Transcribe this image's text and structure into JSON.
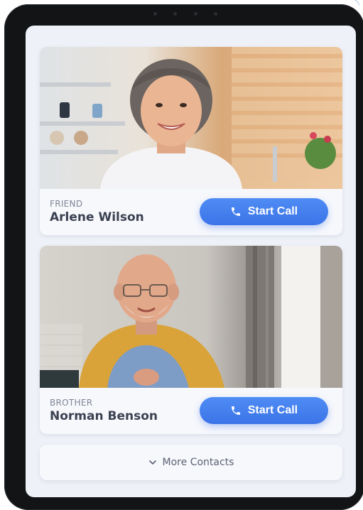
{
  "contacts": [
    {
      "relation": "FRIEND",
      "name": "Arlene Wilson",
      "call_label": "Start Call",
      "photo_icon": "portrait-photo"
    },
    {
      "relation": "BROTHER",
      "name": "Norman Benson",
      "call_label": "Start Call",
      "photo_icon": "portrait-photo"
    }
  ],
  "more_contacts": {
    "label": "More Contacts",
    "icon": "chevron-down-icon"
  },
  "colors": {
    "accent": "#3b74e8",
    "screen_bg": "#eef1f7",
    "card_bg": "#f7f8fc",
    "device_frame": "#121416"
  }
}
